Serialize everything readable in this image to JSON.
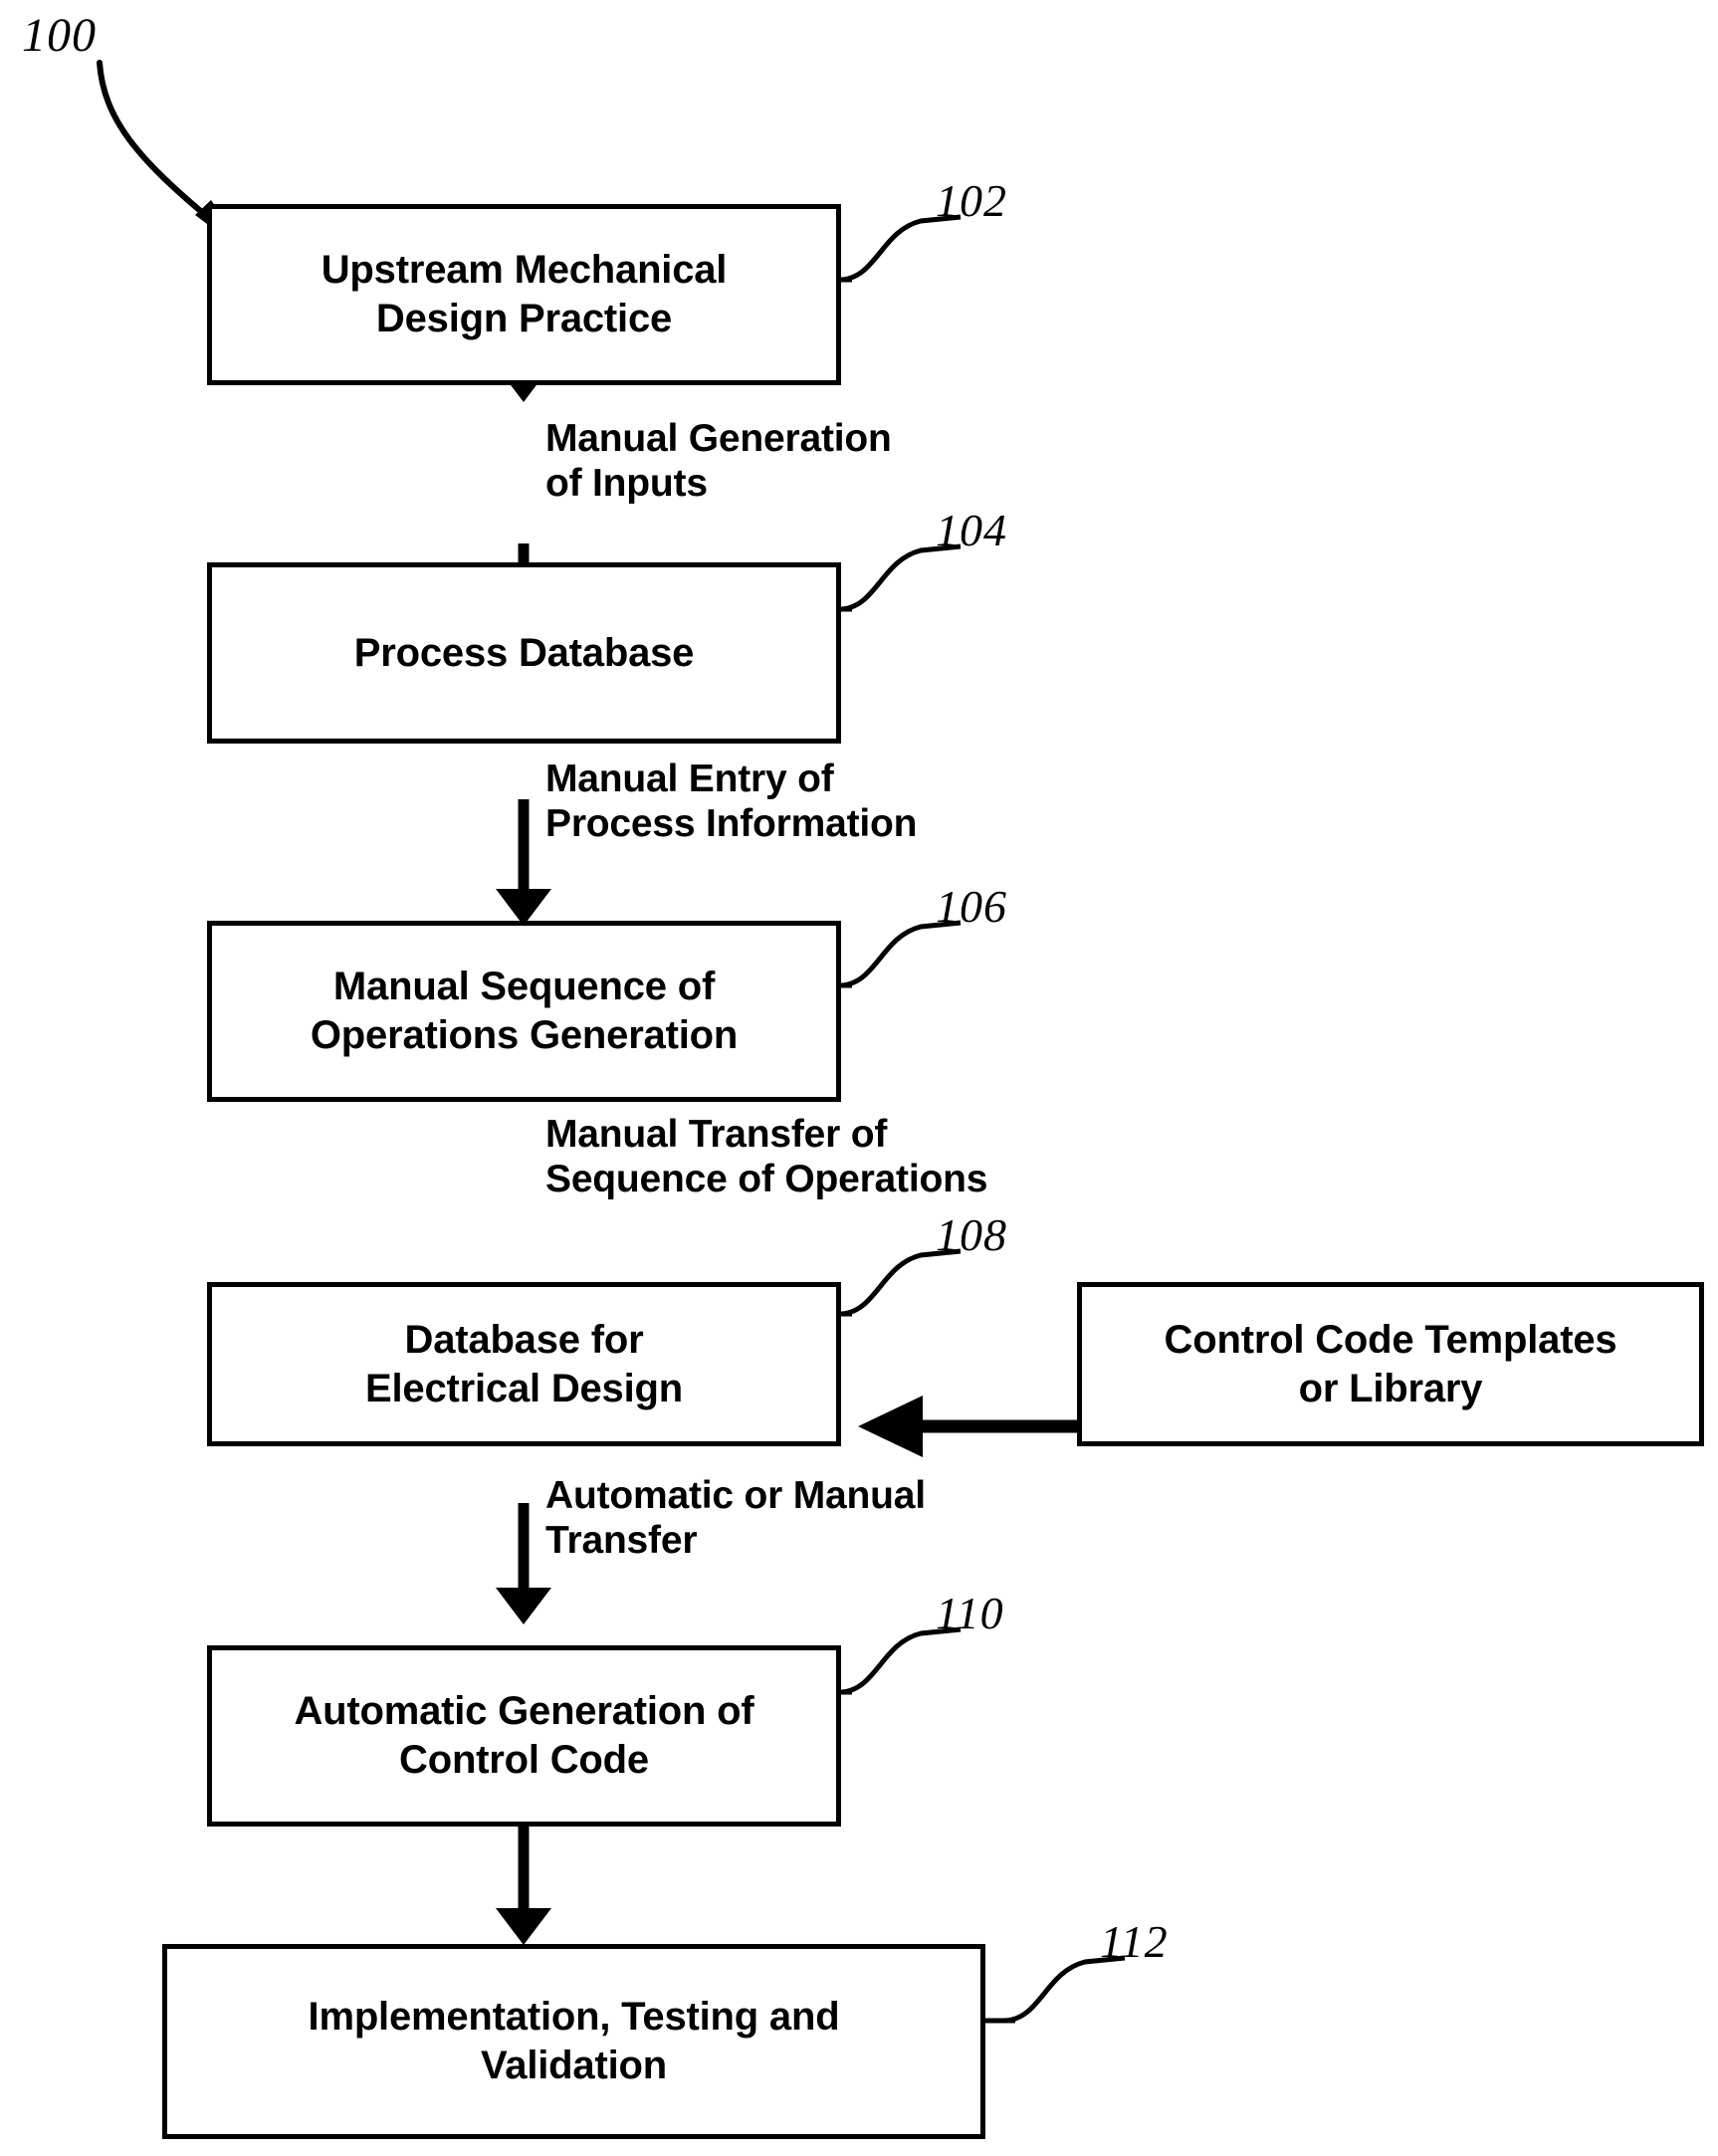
{
  "figure": {
    "number": "100",
    "type": "process-flow-diagram"
  },
  "nodes": [
    {
      "id": "102",
      "ref": "102",
      "label": "Upstream Mechanical\nDesign Practice"
    },
    {
      "id": "104",
      "ref": "104",
      "label": "Process Database"
    },
    {
      "id": "106",
      "ref": "106",
      "label": "Manual Sequence of\nOperations Generation"
    },
    {
      "id": "108",
      "ref": "108",
      "label": "Database for\nElectrical Design"
    },
    {
      "id": "110",
      "ref": "110",
      "label": "Automatic Generation of\nControl Code"
    },
    {
      "id": "112",
      "ref": "112",
      "label": "Implementation, Testing and\nValidation"
    },
    {
      "id": "templates",
      "ref": "",
      "label": "Control Code Templates\nor Library"
    }
  ],
  "edges": [
    {
      "from": "102",
      "to": "104",
      "label": "Manual Generation\nof Inputs",
      "direction": "down"
    },
    {
      "from": "104",
      "to": "106",
      "label": "Manual Entry of\nProcess Information",
      "direction": "down"
    },
    {
      "from": "106",
      "to": "108",
      "label": "Manual Transfer of\nSequence of Operations",
      "direction": "down"
    },
    {
      "from": "templates",
      "to": "108",
      "label": "",
      "direction": "left"
    },
    {
      "from": "108",
      "to": "110",
      "label": "Automatic or Manual\nTransfer",
      "direction": "down"
    },
    {
      "from": "110",
      "to": "112",
      "label": "",
      "direction": "down"
    }
  ],
  "colors": {
    "stroke": "#000000",
    "background": "#ffffff",
    "text": "#000000"
  }
}
